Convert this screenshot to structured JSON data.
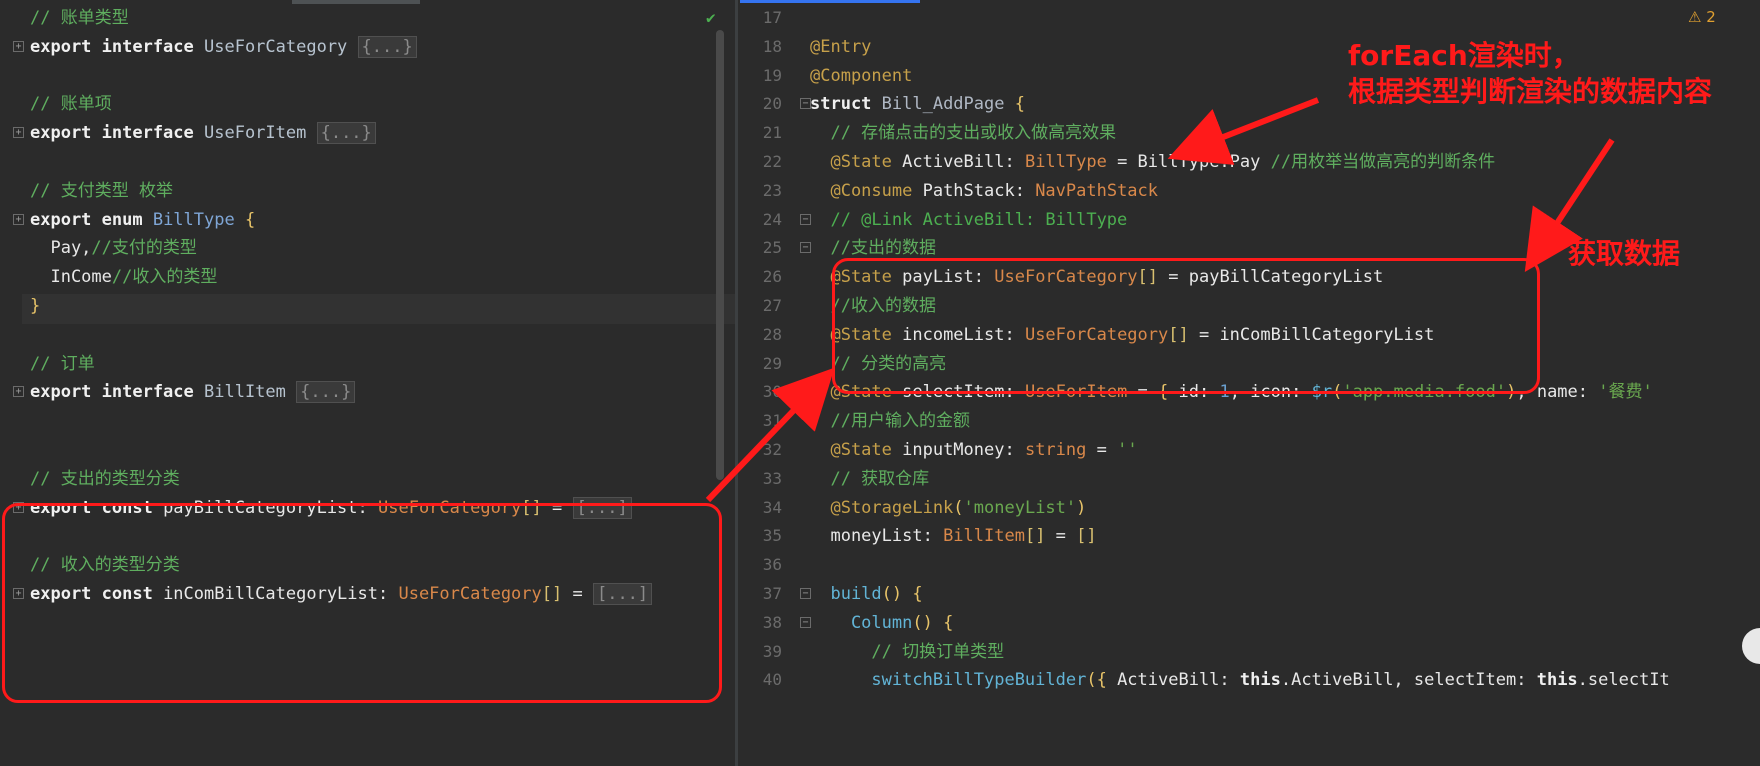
{
  "left": {
    "lines": [
      {
        "tokens": [
          {
            "c": "cmcn",
            "t": "// 账单类型"
          }
        ]
      },
      {
        "tokens": [
          {
            "c": "kw",
            "t": "export interface "
          },
          {
            "c": "iface",
            "t": "UseForCategory "
          },
          {
            "c": "fold",
            "t": "{...}"
          }
        ]
      },
      {
        "tokens": []
      },
      {
        "tokens": [
          {
            "c": "cmcn",
            "t": "// 账单项"
          }
        ]
      },
      {
        "tokens": [
          {
            "c": "kw",
            "t": "export interface "
          },
          {
            "c": "iface",
            "t": "UseForItem "
          },
          {
            "c": "fold",
            "t": "{...}"
          }
        ]
      },
      {
        "tokens": []
      },
      {
        "tokens": [
          {
            "c": "cmcn",
            "t": "// 支付类型 枚举"
          }
        ]
      },
      {
        "tokens": [
          {
            "c": "kw",
            "t": "export enum "
          },
          {
            "c": "enumname",
            "t": "BillType "
          },
          {
            "c": "br",
            "t": "{"
          }
        ]
      },
      {
        "tokens": [
          {
            "c": "member",
            "t": "  Pay,"
          },
          {
            "c": "cmcn",
            "t": "//支付的类型"
          }
        ]
      },
      {
        "tokens": [
          {
            "c": "member",
            "t": "  InCome"
          },
          {
            "c": "cmcn",
            "t": "//收入的类型"
          }
        ]
      },
      {
        "tokens": [
          {
            "c": "br",
            "t": "}"
          }
        ]
      },
      {
        "tokens": []
      },
      {
        "tokens": [
          {
            "c": "cmcn",
            "t": "// 订单"
          }
        ]
      },
      {
        "tokens": [
          {
            "c": "kw",
            "t": "export interface "
          },
          {
            "c": "iface",
            "t": "BillItem "
          },
          {
            "c": "fold",
            "t": "{...}"
          }
        ]
      },
      {
        "tokens": []
      },
      {
        "tokens": []
      },
      {
        "tokens": [
          {
            "c": "cmcn",
            "t": "// 支出的类型分类"
          }
        ]
      },
      {
        "tokens": [
          {
            "c": "kw",
            "t": "export const "
          },
          {
            "c": "member",
            "t": "payBillCategoryList: "
          },
          {
            "c": "type2",
            "t": "UseForCategory"
          },
          {
            "c": "sq",
            "t": "[]"
          },
          {
            "c": "member",
            "t": " = "
          },
          {
            "c": "fold",
            "t": "[...]"
          }
        ]
      },
      {
        "tokens": []
      },
      {
        "tokens": [
          {
            "c": "cmcn",
            "t": "// 收入的类型分类"
          }
        ]
      },
      {
        "tokens": [
          {
            "c": "kw",
            "t": "export const "
          },
          {
            "c": "member",
            "t": "inComBillCategoryList: "
          },
          {
            "c": "type2",
            "t": "UseForCategory"
          },
          {
            "c": "sq",
            "t": "[]"
          },
          {
            "c": "member",
            "t": " = "
          },
          {
            "c": "fold",
            "t": "[...]"
          }
        ]
      }
    ]
  },
  "right": {
    "line_numbers": [
      "17",
      "18",
      "19",
      "20",
      "21",
      "22",
      "23",
      "24",
      "25",
      "26",
      "27",
      "28",
      "29",
      "30",
      "31",
      "32",
      "33",
      "34",
      "35",
      "36",
      "37",
      "38",
      "39",
      "40"
    ],
    "lines": [
      {
        "tokens": []
      },
      {
        "tokens": [
          {
            "c": "ann",
            "t": "@Entry"
          }
        ]
      },
      {
        "tokens": [
          {
            "c": "ann",
            "t": "@Component"
          }
        ]
      },
      {
        "tokens": [
          {
            "c": "kw",
            "t": "struct "
          },
          {
            "c": "type",
            "t": "Bill_AddPage "
          },
          {
            "c": "br",
            "t": "{"
          }
        ]
      },
      {
        "tokens": [
          {
            "c": "cmcn",
            "t": "  // 存储点击的支出或收入做高亮效果"
          }
        ]
      },
      {
        "tokens": [
          {
            "c": "ann",
            "t": "  @State "
          },
          {
            "c": "member",
            "t": "ActiveBill: "
          },
          {
            "c": "type2",
            "t": "BillType"
          },
          {
            "c": "member",
            "t": " = BillType.Pay "
          },
          {
            "c": "cmcn",
            "t": "//用枚举当做高亮的判断条件"
          }
        ]
      },
      {
        "tokens": [
          {
            "c": "ann",
            "t": "  @Consume "
          },
          {
            "c": "member",
            "t": "PathStack: "
          },
          {
            "c": "type2",
            "t": "NavPathStack"
          }
        ]
      },
      {
        "tokens": [
          {
            "c": "cm",
            "t": "  // @Link ActiveBill: BillType"
          }
        ]
      },
      {
        "tokens": [
          {
            "c": "cmcn",
            "t": "  //支出的数据"
          }
        ]
      },
      {
        "tokens": [
          {
            "c": "ann",
            "t": "  @State "
          },
          {
            "c": "member",
            "t": "payList: "
          },
          {
            "c": "type2",
            "t": "UseForCategory"
          },
          {
            "c": "sq",
            "t": "[]"
          },
          {
            "c": "member",
            "t": " = payBillCategoryList"
          }
        ]
      },
      {
        "tokens": [
          {
            "c": "cmcn",
            "t": "  //收入的数据"
          }
        ]
      },
      {
        "tokens": [
          {
            "c": "ann",
            "t": "  @State "
          },
          {
            "c": "member",
            "t": "incomeList: "
          },
          {
            "c": "type2",
            "t": "UseForCategory"
          },
          {
            "c": "sq",
            "t": "[]"
          },
          {
            "c": "member",
            "t": " = inComBillCategoryList"
          }
        ]
      },
      {
        "tokens": [
          {
            "c": "cmcn",
            "t": "  // 分类的高亮"
          }
        ]
      },
      {
        "tokens": [
          {
            "c": "ann",
            "t": "  @State "
          },
          {
            "c": "member",
            "t": "selectItem: "
          },
          {
            "c": "type2",
            "t": "UseForItem"
          },
          {
            "c": "member",
            "t": " = "
          },
          {
            "c": "br",
            "t": "{ "
          },
          {
            "c": "member",
            "t": "id: "
          },
          {
            "c": "num",
            "t": "1"
          },
          {
            "c": "member",
            "t": ", icon: "
          },
          {
            "c": "fn",
            "t": "$r"
          },
          {
            "c": "br",
            "t": "("
          },
          {
            "c": "str",
            "t": "'app.media.food'"
          },
          {
            "c": "br",
            "t": ")"
          },
          {
            "c": "member",
            "t": ", name: "
          },
          {
            "c": "str",
            "t": "'餐费'"
          }
        ]
      },
      {
        "tokens": [
          {
            "c": "cmcn",
            "t": "  //用户输入的金额"
          }
        ]
      },
      {
        "tokens": [
          {
            "c": "ann",
            "t": "  @State "
          },
          {
            "c": "member",
            "t": "inputMoney: "
          },
          {
            "c": "type2",
            "t": "string"
          },
          {
            "c": "member",
            "t": " = "
          },
          {
            "c": "str",
            "t": "''"
          }
        ]
      },
      {
        "tokens": [
          {
            "c": "cmcn",
            "t": "  // 获取仓库"
          }
        ]
      },
      {
        "tokens": [
          {
            "c": "ann",
            "t": "  @StorageLink"
          },
          {
            "c": "br",
            "t": "("
          },
          {
            "c": "str",
            "t": "'moneyList'"
          },
          {
            "c": "br",
            "t": ")"
          }
        ]
      },
      {
        "tokens": [
          {
            "c": "member",
            "t": "  moneyList: "
          },
          {
            "c": "type2",
            "t": "BillItem"
          },
          {
            "c": "sq",
            "t": "[]"
          },
          {
            "c": "member",
            "t": " = "
          },
          {
            "c": "sq",
            "t": "[]"
          }
        ]
      },
      {
        "tokens": []
      },
      {
        "tokens": [
          {
            "c": "fn",
            "t": "  build"
          },
          {
            "c": "br",
            "t": "() {"
          }
        ]
      },
      {
        "tokens": [
          {
            "c": "fn",
            "t": "    Column"
          },
          {
            "c": "br",
            "t": "() {"
          }
        ]
      },
      {
        "tokens": [
          {
            "c": "cmcn",
            "t": "      // 切换订单类型"
          }
        ]
      },
      {
        "tokens": [
          {
            "c": "fn",
            "t": "      switchBillTypeBuilder"
          },
          {
            "c": "br",
            "t": "({ "
          },
          {
            "c": "member",
            "t": "ActiveBill: "
          },
          {
            "c": "kw",
            "t": "this"
          },
          {
            "c": "member",
            "t": ".ActiveBill, selectItem: "
          },
          {
            "c": "kw",
            "t": "this"
          },
          {
            "c": "member",
            "t": ".selectIt"
          }
        ]
      }
    ],
    "warning_count": "2"
  },
  "annotations": {
    "note_top": "forEach渲染时，\n根据类型判断渲染的数据内容",
    "note_side": "获取数据"
  },
  "colors": {
    "annotation": "#ff1a1a",
    "background": "#2b2b2b"
  }
}
